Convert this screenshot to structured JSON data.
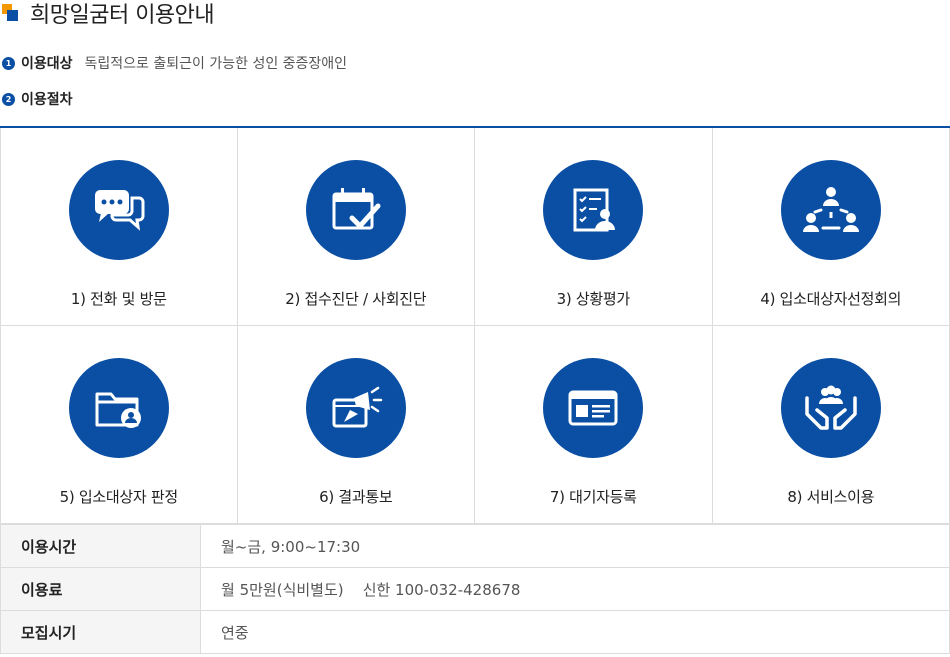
{
  "header": {
    "title": "희망일굼터 이용안내"
  },
  "info": [
    {
      "num": "1",
      "label": "이용대상",
      "desc": "독립적으로 출퇴근이 가능한 성인 중증장애인"
    },
    {
      "num": "2",
      "label": "이용절차",
      "desc": ""
    }
  ],
  "steps": [
    {
      "label": "1) 전화 및 방문",
      "icon": "chat-bubbles-icon"
    },
    {
      "label": "2) 접수진단 / 사회진단",
      "icon": "calendar-check-icon"
    },
    {
      "label": "3) 상황평가",
      "icon": "checklist-person-icon"
    },
    {
      "label": "4) 입소대상자선정회의",
      "icon": "meeting-people-icon"
    },
    {
      "label": "5) 입소대상자 판정",
      "icon": "folder-user-icon"
    },
    {
      "label": "6) 결과통보",
      "icon": "megaphone-icon"
    },
    {
      "label": "7) 대기자등록",
      "icon": "id-card-icon"
    },
    {
      "label": "8) 서비스이용",
      "icon": "hands-people-icon"
    }
  ],
  "table": [
    {
      "label": "이용시간",
      "value": "월~금, 9:00~17:30"
    },
    {
      "label": "이용료",
      "value": "월 5만원(식비별도)    신한 100-032-428678"
    },
    {
      "label": "모집시기",
      "value": "연중"
    }
  ],
  "colors": {
    "primary": "#0a4fa3",
    "accent": "#f39800",
    "border": "#dcdcdc"
  }
}
